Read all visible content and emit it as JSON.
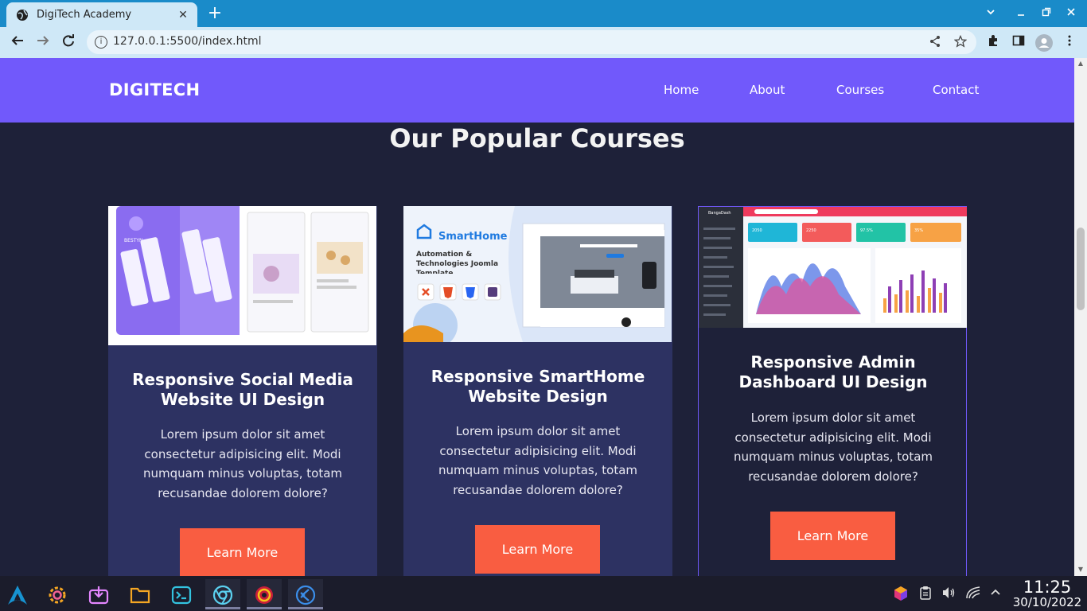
{
  "browser": {
    "tab_title": "DigiTech Academy",
    "tab_close": "✕",
    "new_tab": "+",
    "url": "127.0.0.1:5500/index.html"
  },
  "site": {
    "brand": "DIGITECH",
    "nav": [
      "Home",
      "About",
      "Courses",
      "Contact"
    ],
    "section_title": "Our Popular Courses"
  },
  "courses": [
    {
      "title": "Responsive Social Media Website UI Design",
      "description": "Lorem ipsum dolor sit amet consectetur adipisicing elit. Modi numquam minus voluptas, totam recusandae dolorem dolore?",
      "button": "Learn More",
      "thumb": {
        "app_name": "BESTYN"
      }
    },
    {
      "title": "Responsive SmartHome Website Design",
      "description": "Lorem ipsum dolor sit amet consectetur adipisicing elit. Modi numquam minus voluptas, totam recusandae dolorem dolore?",
      "button": "Learn More",
      "thumb": {
        "logo": "SmartHome",
        "tagline": "Automation & Technologies Joomla Template"
      }
    },
    {
      "title": "Responsive Admin Dashboard UI Design",
      "description": "Lorem ipsum dolor sit amet consectetur adipisicing elit. Modi numquam minus voluptas, totam recusandae dolorem dolore?",
      "button": "Learn More",
      "thumb": {
        "app": "BangaDash",
        "stats": [
          "2050",
          "2250",
          "97.5%",
          "35%"
        ]
      }
    }
  ],
  "taskbar": {
    "time": "11:25",
    "date": "30/10/2022"
  },
  "colors": {
    "accent": "#7159fb",
    "button": "#f95d41",
    "page_bg": "#1e2139",
    "card_bg": "#2d3262",
    "chrome": "#1a8bc9"
  }
}
